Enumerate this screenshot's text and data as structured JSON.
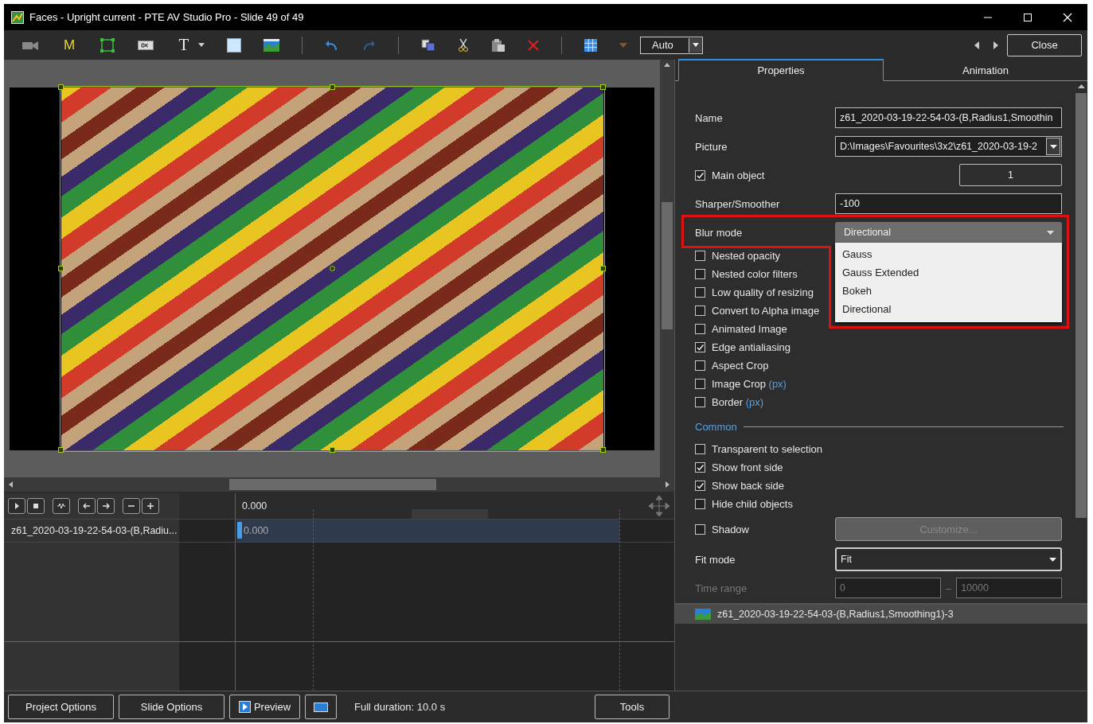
{
  "window": {
    "title": "Faces - Upright current - PTE AV Studio Pro - Slide 49 of 49"
  },
  "toolbar": {
    "marker_label": "M",
    "text_label": "T",
    "zoom": "Auto",
    "close": "Close"
  },
  "tabs": [
    {
      "label": "Properties",
      "selected": true
    },
    {
      "label": "Animation",
      "selected": false
    }
  ],
  "properties": {
    "name": {
      "label": "Name",
      "value": "z61_2020-03-19-22-54-03-(B,Radius1,Smoothin"
    },
    "picture": {
      "label": "Picture",
      "value": "D:\\Images\\Favourites\\3x2\\z61_2020-03-19-2"
    },
    "main_object": {
      "label": "Main object",
      "checked": true,
      "value": "1"
    },
    "sharper": {
      "label": "Sharper/Smoother",
      "value": "-100"
    },
    "blur_mode": {
      "label": "Blur mode",
      "value": "Directional",
      "expanded": true,
      "highlighted": true,
      "options": [
        "Gauss",
        "Gauss Extended",
        "Bokeh",
        "Directional"
      ]
    },
    "options": [
      {
        "label": "Nested opacity",
        "checked": false
      },
      {
        "label": "Nested color filters",
        "checked": false
      },
      {
        "label": "Low quality of resizing",
        "checked": false
      },
      {
        "label": "Convert to Alpha image",
        "checked": false
      },
      {
        "label": "Animated Image",
        "checked": false
      },
      {
        "label": "Edge antialiasing",
        "checked": true
      },
      {
        "label": "Aspect Crop",
        "checked": false
      },
      {
        "label": "Image Crop",
        "unit": "(px)",
        "checked": false
      },
      {
        "label": "Border",
        "unit": "(px)",
        "checked": false
      }
    ],
    "common": {
      "heading": "Common",
      "options": [
        {
          "label": "Transparent to selection",
          "checked": false
        },
        {
          "label": "Show front side",
          "checked": true
        },
        {
          "label": "Show back side",
          "checked": true
        },
        {
          "label": "Hide child objects",
          "checked": false
        }
      ]
    },
    "shadow": {
      "label": "Shadow",
      "checked": false,
      "button": "Customize...",
      "button_disabled": true
    },
    "fit_mode": {
      "label": "Fit mode",
      "value": "Fit"
    },
    "time_range": {
      "label": "Time range",
      "from": "0",
      "separator": "–",
      "to": "10000",
      "disabled": true
    }
  },
  "objects": [
    {
      "name": "z61_2020-03-19-22-54-03-(B,Radius1,Smoothing1)-3",
      "selected": true
    }
  ],
  "timeline": {
    "time": "0.000",
    "tracks": [
      {
        "name": "z61_2020-03-19-22-54-03-(B,Radiu...",
        "start": "0.000"
      }
    ]
  },
  "bottom_bar": {
    "project_options": "Project Options",
    "slide_options": "Slide Options",
    "preview": "Preview",
    "duration": "Full duration: 10.0 s",
    "tools": "Tools"
  }
}
